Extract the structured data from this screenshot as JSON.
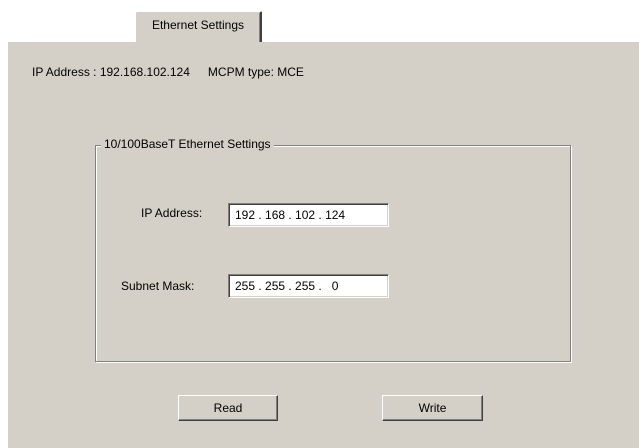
{
  "tabs": [
    {
      "label": "Ethernet Settings",
      "selected": true
    }
  ],
  "info": {
    "ip_address": "IP Address : 192.168.102.124",
    "mcpm_type": "MCPM type: MCE"
  },
  "group": {
    "title": "10/100BaseT Ethernet Settings",
    "ip_label": "IP Address:",
    "ip_value": "192 . 168 . 102 . 124",
    "subnet_label": "Subnet Mask:",
    "subnet_value": "255 . 255 . 255 .   0"
  },
  "buttons": {
    "read_label": "Read",
    "write_label": "Write"
  },
  "colors": {
    "panel_background": "#d4d0c8",
    "field_background": "#ffffff",
    "text": "#000000"
  }
}
